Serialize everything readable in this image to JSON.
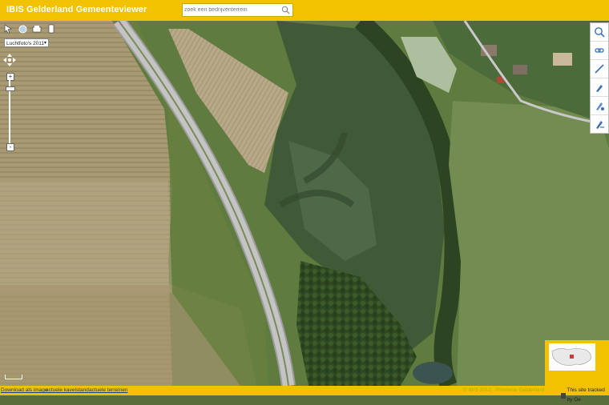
{
  "header": {
    "title": "IBIS Gelderland Gemeenteviewer",
    "search_placeholder": "zoek een bedrijventerrein"
  },
  "map_controls": {
    "tools": [
      "pointer-icon",
      "globe-icon",
      "print-icon",
      "bookmark-icon"
    ],
    "layer_selected": "Luchtfoto's 2011",
    "zoom_in": "+",
    "zoom_out": "-",
    "zoom_level_fraction": 0.1
  },
  "right_tools": [
    "zoom-search-icon",
    "link-icon",
    "measure-icon",
    "pin-icon",
    "draw-icon",
    "clear-icon"
  ],
  "footer": {
    "download": "Download als image",
    "link_kavelstand": "actuele kavelstand",
    "link_terreinen": "actuele terreinen",
    "faint_text": "© IBIS 2012 · Provincie Gelderland",
    "tracked": "This site tracked by Oe"
  },
  "colors": {
    "brand_yellow": "#f2c200",
    "grass": "#5d7a3c",
    "field_light": "#b7a47d",
    "road": "#b9b9b9"
  }
}
